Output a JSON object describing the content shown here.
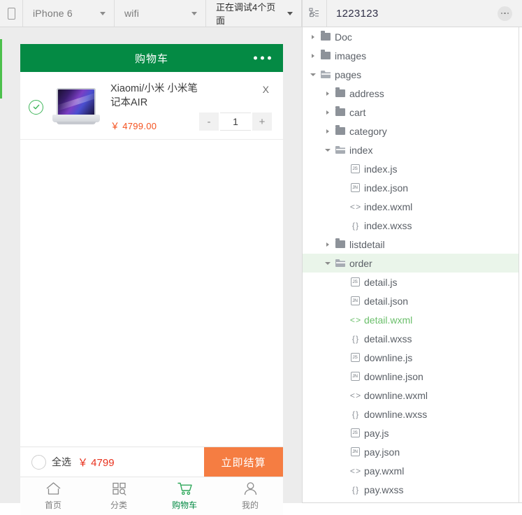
{
  "toolbar": {
    "device_icon": "phone-icon",
    "device": "iPhone 6",
    "network": "wifi",
    "debug_status": "正在调试4个页面",
    "tree_icon": "sitemap-icon",
    "project_name": "1223123",
    "more_icon": "ellipsis-icon"
  },
  "simulator": {
    "nav": {
      "title": "购物车",
      "more_icon": "ellipsis-icon"
    },
    "items": [
      {
        "selected_icon": "check-circle-icon",
        "thumb_icon": "laptop-image",
        "title": "Xiaomi/小米 小米笔记本AIR",
        "price": "￥ 4799.00",
        "remove_label": "X",
        "minus_label": "-",
        "qty": "1",
        "plus_label": "+"
      }
    ],
    "total_bar": {
      "select_all_icon": "circle-icon",
      "select_all_label": "全选",
      "amount": "￥ 4799",
      "checkout_label": "立即结算",
      "checkout_color": "#f57d42",
      "amount_color": "#e8321e"
    },
    "tabs": [
      {
        "label": "首页",
        "icon": "home-icon",
        "active": false
      },
      {
        "label": "分类",
        "icon": "grid-search-icon",
        "active": false
      },
      {
        "label": "购物车",
        "icon": "cart-icon",
        "active": true
      },
      {
        "label": "我的",
        "icon": "user-icon",
        "active": false
      }
    ],
    "accent_green": "#048a44"
  },
  "file_tree": {
    "rows": [
      {
        "label": "Doc",
        "indent": 0,
        "type": "folder",
        "state": "collapsed"
      },
      {
        "label": "images",
        "indent": 0,
        "type": "folder",
        "state": "collapsed"
      },
      {
        "label": "pages",
        "indent": 0,
        "type": "folder",
        "state": "expanded"
      },
      {
        "label": "address",
        "indent": 1,
        "type": "folder",
        "state": "collapsed"
      },
      {
        "label": "cart",
        "indent": 1,
        "type": "folder",
        "state": "collapsed"
      },
      {
        "label": "category",
        "indent": 1,
        "type": "folder",
        "state": "collapsed"
      },
      {
        "label": "index",
        "indent": 1,
        "type": "folder",
        "state": "expanded"
      },
      {
        "label": "index.js",
        "indent": 2,
        "type": "js"
      },
      {
        "label": "index.json",
        "indent": 2,
        "type": "json"
      },
      {
        "label": "index.wxml",
        "indent": 2,
        "type": "wxml"
      },
      {
        "label": "index.wxss",
        "indent": 2,
        "type": "wxss"
      },
      {
        "label": "listdetail",
        "indent": 1,
        "type": "folder",
        "state": "collapsed"
      },
      {
        "label": "order",
        "indent": 1,
        "type": "folder",
        "state": "expanded",
        "selected": true
      },
      {
        "label": "detail.js",
        "indent": 2,
        "type": "js"
      },
      {
        "label": "detail.json",
        "indent": 2,
        "type": "json"
      },
      {
        "label": "detail.wxml",
        "indent": 2,
        "type": "wxml",
        "highlight": true
      },
      {
        "label": "detail.wxss",
        "indent": 2,
        "type": "wxss"
      },
      {
        "label": "downline.js",
        "indent": 2,
        "type": "js"
      },
      {
        "label": "downline.json",
        "indent": 2,
        "type": "json"
      },
      {
        "label": "downline.wxml",
        "indent": 2,
        "type": "wxml"
      },
      {
        "label": "downline.wxss",
        "indent": 2,
        "type": "wxss"
      },
      {
        "label": "pay.js",
        "indent": 2,
        "type": "js"
      },
      {
        "label": "pay.json",
        "indent": 2,
        "type": "json"
      },
      {
        "label": "pay.wxml",
        "indent": 2,
        "type": "wxml"
      },
      {
        "label": "pay.wxss",
        "indent": 2,
        "type": "wxss"
      }
    ],
    "icon_text": {
      "js": "JS",
      "json": "JN",
      "wxml": "< >",
      "wxss": "{ }"
    },
    "highlight_color": "#6bbf6b",
    "selected_row_bg": "#eaf5ea"
  }
}
